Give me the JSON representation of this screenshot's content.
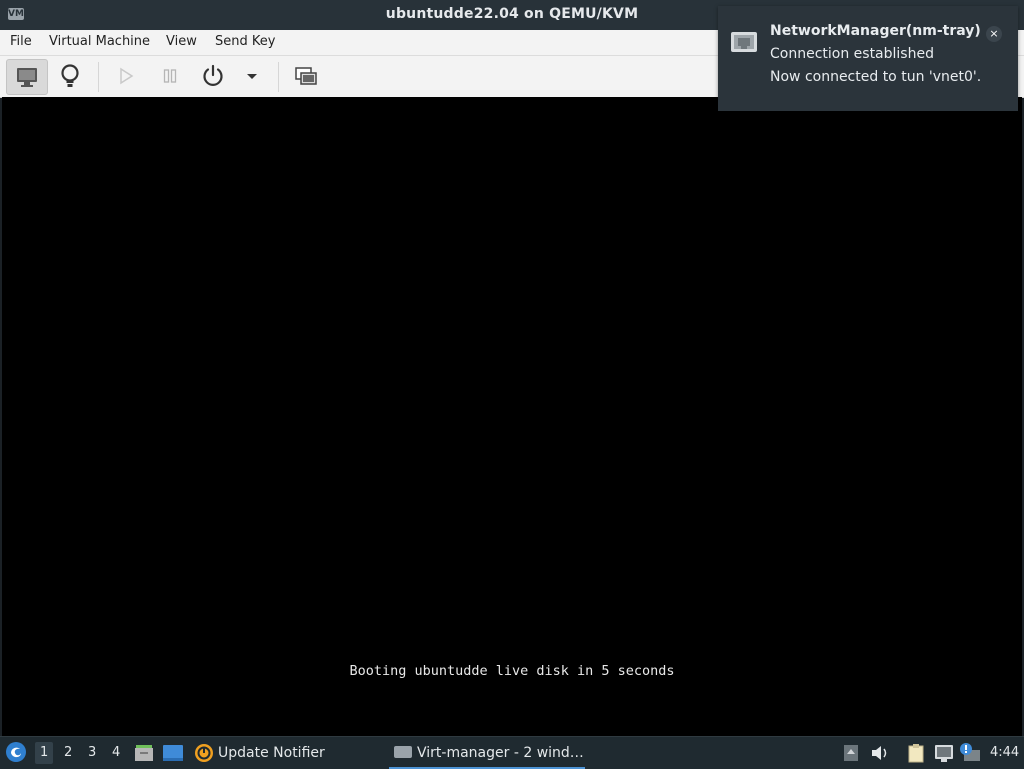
{
  "window": {
    "title": "ubuntudde22.04 on QEMU/KVM",
    "app_icon_text": "VM"
  },
  "menu": {
    "items": [
      "File",
      "Virtual Machine",
      "View",
      "Send Key"
    ]
  },
  "toolbar": {
    "buttons": [
      {
        "name": "console",
        "icon": "monitor-icon",
        "active": true
      },
      {
        "name": "details",
        "icon": "lightbulb-icon",
        "active": false
      },
      {
        "name": "run",
        "icon": "play-icon",
        "enabled": false
      },
      {
        "name": "pause",
        "icon": "pause-icon",
        "enabled": false
      },
      {
        "name": "shutdown",
        "icon": "power-icon"
      },
      {
        "name": "shutdown-menu",
        "icon": "chevron-down-icon"
      },
      {
        "name": "fullscreen",
        "icon": "screens-icon"
      }
    ]
  },
  "vm_screen": {
    "boot_message": "Booting ubuntudde live disk in 5 seconds"
  },
  "notification": {
    "app": "NetworkManager(nm-tray)",
    "summary": "Connection established",
    "body": "Now connected to tun 'vnet0'.",
    "close_label": "×",
    "icon": "network-ethernet-icon"
  },
  "taskbar": {
    "workspaces": [
      "1",
      "2",
      "3",
      "4"
    ],
    "current_workspace": "1",
    "update_notifier_label": "Update Notifier",
    "window_button_label": "Virt-manager - 2 wind…",
    "clock": "4:44",
    "tray_icons": [
      "up-arrow-icon",
      "volume-icon",
      "clipboard-icon",
      "network-icon",
      "notification-icon",
      "display-icon"
    ]
  },
  "colors": {
    "titlebar_bg": "#283239",
    "taskbar_bg": "#1f2a30",
    "notification_bg": "#2b343b",
    "accent": "#4d94d6"
  }
}
